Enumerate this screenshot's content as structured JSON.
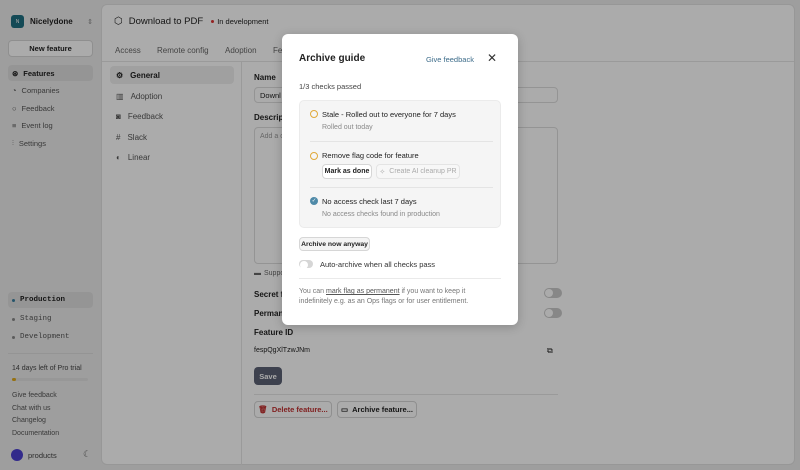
{
  "workspace": {
    "initial": "N",
    "name": "Nicelydone"
  },
  "sidebar": {
    "new_feature": "New feature",
    "items": [
      {
        "label": "Features",
        "icon": "features-icon"
      },
      {
        "label": "Companies",
        "icon": "companies-icon"
      },
      {
        "label": "Feedback",
        "icon": "feedback-icon"
      },
      {
        "label": "Event log",
        "icon": "event-log-icon"
      },
      {
        "label": "Settings",
        "icon": "settings-icon"
      }
    ],
    "environments": [
      "Production",
      "Staging",
      "Development"
    ],
    "trial": {
      "text": "14 days left of Pro trial",
      "progress": 0.05
    },
    "links": [
      "Give feedback",
      "Chat with us",
      "Changelog",
      "Documentation"
    ],
    "user": "products"
  },
  "header": {
    "title": "Download to PDF",
    "status": "In development",
    "status_color": "#d33"
  },
  "tabs": [
    "Access",
    "Remote config",
    "Adoption",
    "Fe"
  ],
  "subnav": [
    "General",
    "Adoption",
    "Feedback",
    "Slack",
    "Linear"
  ],
  "form": {
    "name_label": "Name",
    "name_value": "Downl",
    "description_label": "Descript",
    "description_placeholder": "Add a d",
    "support_text": "Suppo",
    "secret_label": "Secret f",
    "permanent_label": "Permane",
    "feature_id_label": "Feature ID",
    "feature_id": "fespQgXlTzwJNm",
    "save": "Save",
    "delete": "Delete feature...",
    "archive": "Archive feature..."
  },
  "modal": {
    "title": "Archive guide",
    "give_feedback": "Give feedback",
    "summary": "1/3 checks passed",
    "checks": [
      {
        "title": "Stale - Rolled out to everyone for 7 days",
        "subtitle": "Rolled out today",
        "status": "pending"
      },
      {
        "title": "Remove flag code for feature",
        "status": "pending",
        "mark_done": "Mark as done",
        "ai_pr": "Create AI cleanup PR"
      },
      {
        "title": "No access check last 7 days",
        "subtitle": "No access checks found in production",
        "status": "passed"
      }
    ],
    "archive_now": "Archive now anyway",
    "auto_archive": "Auto-archive when all checks pass",
    "auto_archive_on": false,
    "footer_pre": "You can ",
    "footer_link": "mark flag as permanent",
    "footer_post": " if you want to keep it indefinitely e.g. as an Ops flags or for user entitlement."
  }
}
